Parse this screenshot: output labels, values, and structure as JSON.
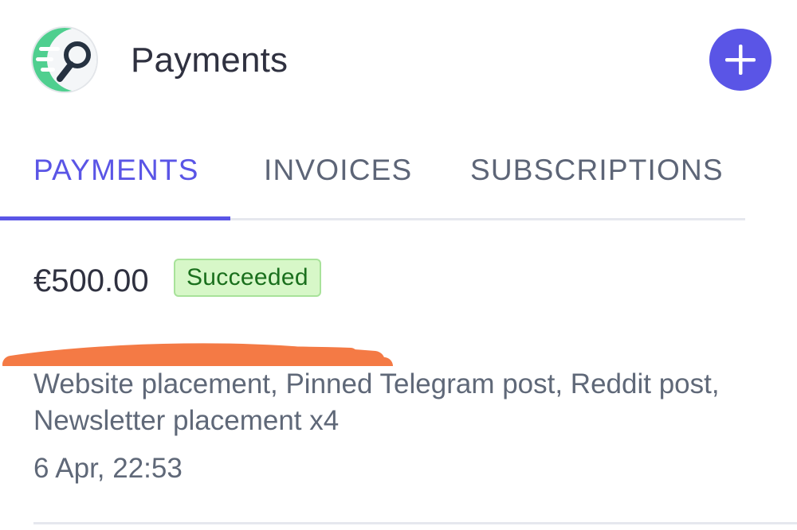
{
  "header": {
    "title": "Payments",
    "logo_icon": "magnifier-speed-logo-icon",
    "add_icon": "plus-icon"
  },
  "tabs": [
    {
      "label": "PAYMENTS",
      "active": true
    },
    {
      "label": "INVOICES",
      "active": false
    },
    {
      "label": "SUBSCRIPTIONS",
      "active": false
    }
  ],
  "payment": {
    "amount": "€500.00",
    "status": "Succeeded",
    "description": "Website placement, Pinned Telegram post, Reddit post, Newsletter placement x4",
    "timestamp": "6 Apr, 22:53"
  },
  "colors": {
    "accent": "#5a55e6",
    "text_primary": "#2f3140",
    "text_secondary": "#5f6878",
    "badge_bg": "#d7f7c8",
    "badge_text": "#1a6f1d",
    "redaction": "#f47a45"
  }
}
